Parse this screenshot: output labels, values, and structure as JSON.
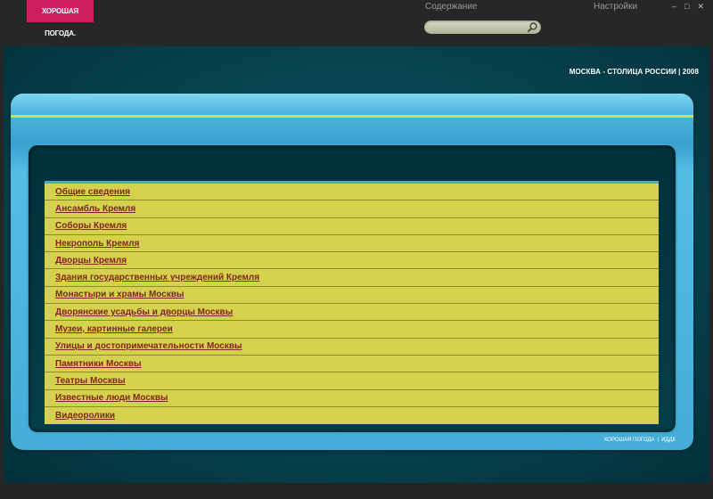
{
  "app": {
    "logo_text": "ХОРОШАЯ ПОГОДА.",
    "brand_color": "#cd1f5e",
    "accent_color": "#d4d24c",
    "link_color": "#862320"
  },
  "topbar": {
    "nav_contents": "Содержание",
    "nav_settings": "Настройки",
    "window_controls": {
      "minimize": "–",
      "maximize": "□",
      "close": "✕"
    },
    "search": {
      "value": "",
      "placeholder": "",
      "icon": "search-icon"
    }
  },
  "main": {
    "header_title": "МОСКВА - СТОЛИЦА РОССИИ | 2008",
    "menu": [
      {
        "label": "Общие сведения"
      },
      {
        "label": "Ансамбль Кремля"
      },
      {
        "label": "Соборы Кремля"
      },
      {
        "label": "Некрополь Кремля"
      },
      {
        "label": "Дворцы Кремля"
      },
      {
        "label": "Здания государственных учреждений Кремля"
      },
      {
        "label": "Монастыри и храмы Москвы"
      },
      {
        "label": "Дворянские усадьбы и дворцы Москвы"
      },
      {
        "label": "Музеи, картинные галереи"
      },
      {
        "label": "Улицы и достопримечательности Москвы"
      },
      {
        "label": "Памятники Москвы"
      },
      {
        "label": "Театры Москвы"
      },
      {
        "label": "Известные люди Москвы"
      },
      {
        "label": "Видеоролики"
      }
    ],
    "footer": {
      "link1": "ХОРОШАЯ ПОГОДА",
      "separator": "|",
      "link2": "ИДДК"
    }
  }
}
